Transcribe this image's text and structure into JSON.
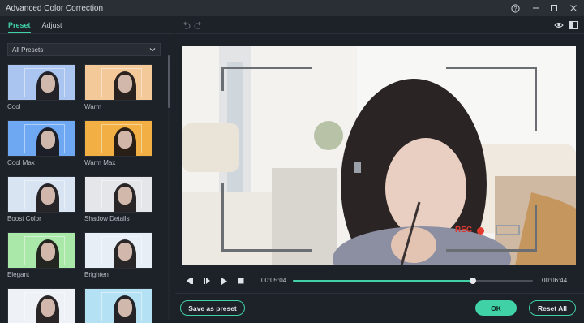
{
  "window": {
    "title": "Advanced Color Correction"
  },
  "tabs": [
    {
      "label": "Preset"
    },
    {
      "label": "Adjust"
    }
  ],
  "dropdown": {
    "selected": "All Presets"
  },
  "presets": [
    {
      "label": "Cool",
      "tint": "#a9c5f0"
    },
    {
      "label": "Warm",
      "tint": "#f4c99a"
    },
    {
      "label": "Cool Max",
      "tint": "#6fa8f2"
    },
    {
      "label": "Warm Max",
      "tint": "#f2b044"
    },
    {
      "label": "Boost Color",
      "tint": "#d9e4f2"
    },
    {
      "label": "Shadow Details",
      "tint": "#e4e6ea"
    },
    {
      "label": "Elegant",
      "tint": "#a9e8a8"
    },
    {
      "label": "Brighten",
      "tint": "#e8eef6"
    },
    {
      "label": "",
      "tint": "#eef1f5"
    },
    {
      "label": "",
      "tint": "#b4e2f4"
    }
  ],
  "player": {
    "current_time": "00:05:04",
    "total_time": "00:06:44",
    "progress": 0.75
  },
  "viewer": {
    "rec_label": "REC"
  },
  "buttons": {
    "save_preset": "Save as preset",
    "ok": "OK",
    "reset_all": "Reset All"
  },
  "colors": {
    "accent": "#40d1a6",
    "background": "#1d2128",
    "titlebar": "#2a2e35"
  }
}
